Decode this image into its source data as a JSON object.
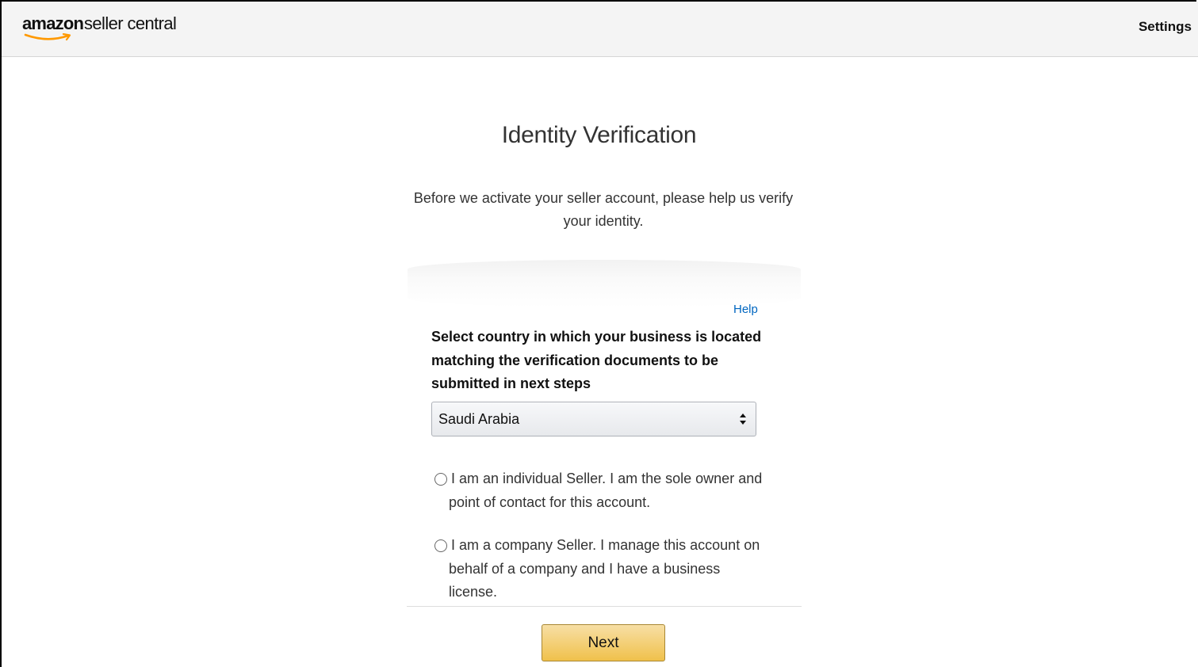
{
  "header": {
    "logo_brand": "amazon",
    "logo_product": "seller central",
    "settings_label": "Settings"
  },
  "main": {
    "title": "Identity Verification",
    "intro": "Before we activate your seller account, please help us verify your identity.",
    "help_label": "Help",
    "country_prompt": "Select country in which your business is located matching the verification documents to be submitted in next steps",
    "country_select": {
      "selected": "Saudi Arabia"
    },
    "seller_options": [
      {
        "label": "I am an individual Seller. I am the sole owner and point of contact for this account.",
        "selected": false
      },
      {
        "label": "I am a company Seller. I manage this account on behalf of a company and I have a business license.",
        "selected": false
      }
    ],
    "next_label": "Next"
  },
  "colors": {
    "link": "#0066c0",
    "button_top": "#f7dfa5",
    "button_bottom": "#f0c14b",
    "header_bg": "#f4f4f4",
    "amazon_smile": "#ff9900"
  },
  "icons": {
    "select_arrows": "updown-arrows-icon",
    "radio": "radio-unchecked-icon",
    "smile": "amazon-smile-icon"
  }
}
